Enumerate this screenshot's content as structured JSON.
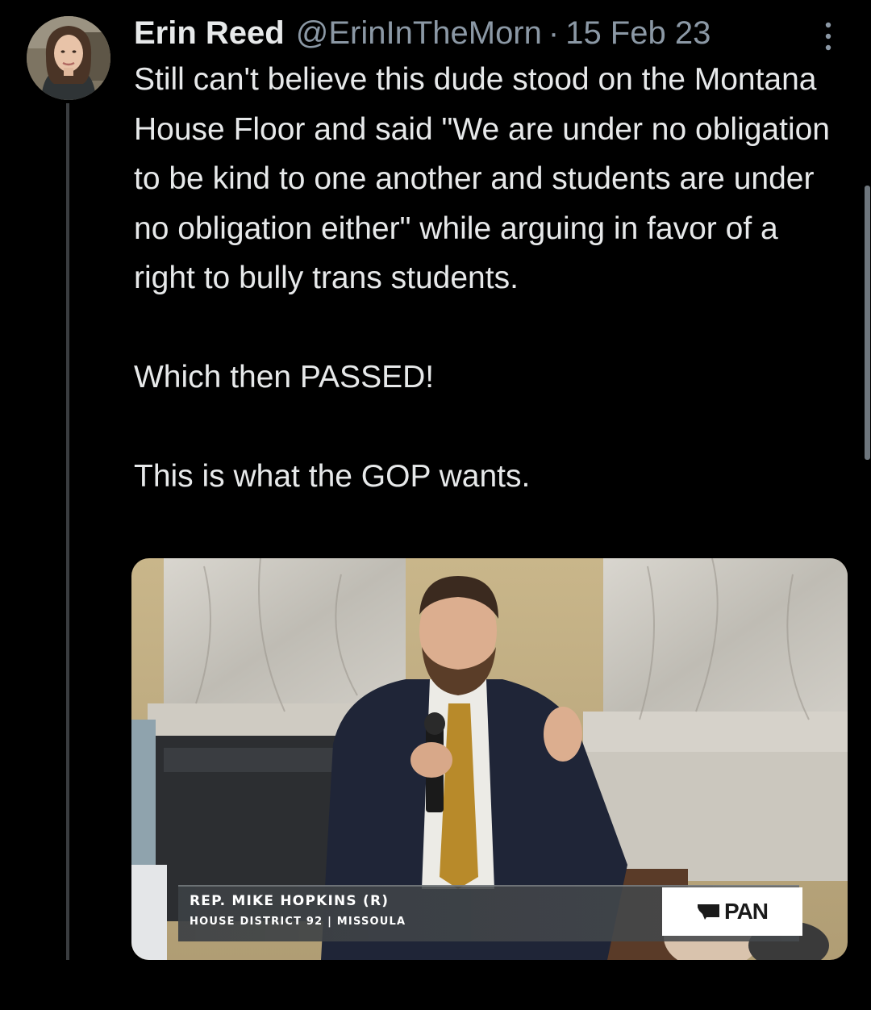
{
  "tweet": {
    "author_name": "Erin Reed",
    "handle": "@ErinInTheMorn",
    "separator": "·",
    "date": "15 Feb 23",
    "text": "Still can't believe this dude stood on the Montana House Floor and said \"We are under no obligation to be kind to one another and students are under no obligation either\" while arguing in favor of a right to bully trans students.\n\nWhich then PASSED!\n\nThis is what the GOP wants."
  },
  "media": {
    "lower_third_name": "REP. MIKE HOPKINS (R)",
    "lower_third_district": "HOUSE DISTRICT 92 | MISSOULA",
    "logo_text": "PAN",
    "logo_icon": "montana-state-shape-icon"
  },
  "icons": {
    "more": "more-vertical-icon"
  },
  "colors": {
    "background": "#000000",
    "primary_text": "#e7e9ea",
    "secondary_text": "#8b98a5",
    "thread_line": "#3a3d40"
  }
}
